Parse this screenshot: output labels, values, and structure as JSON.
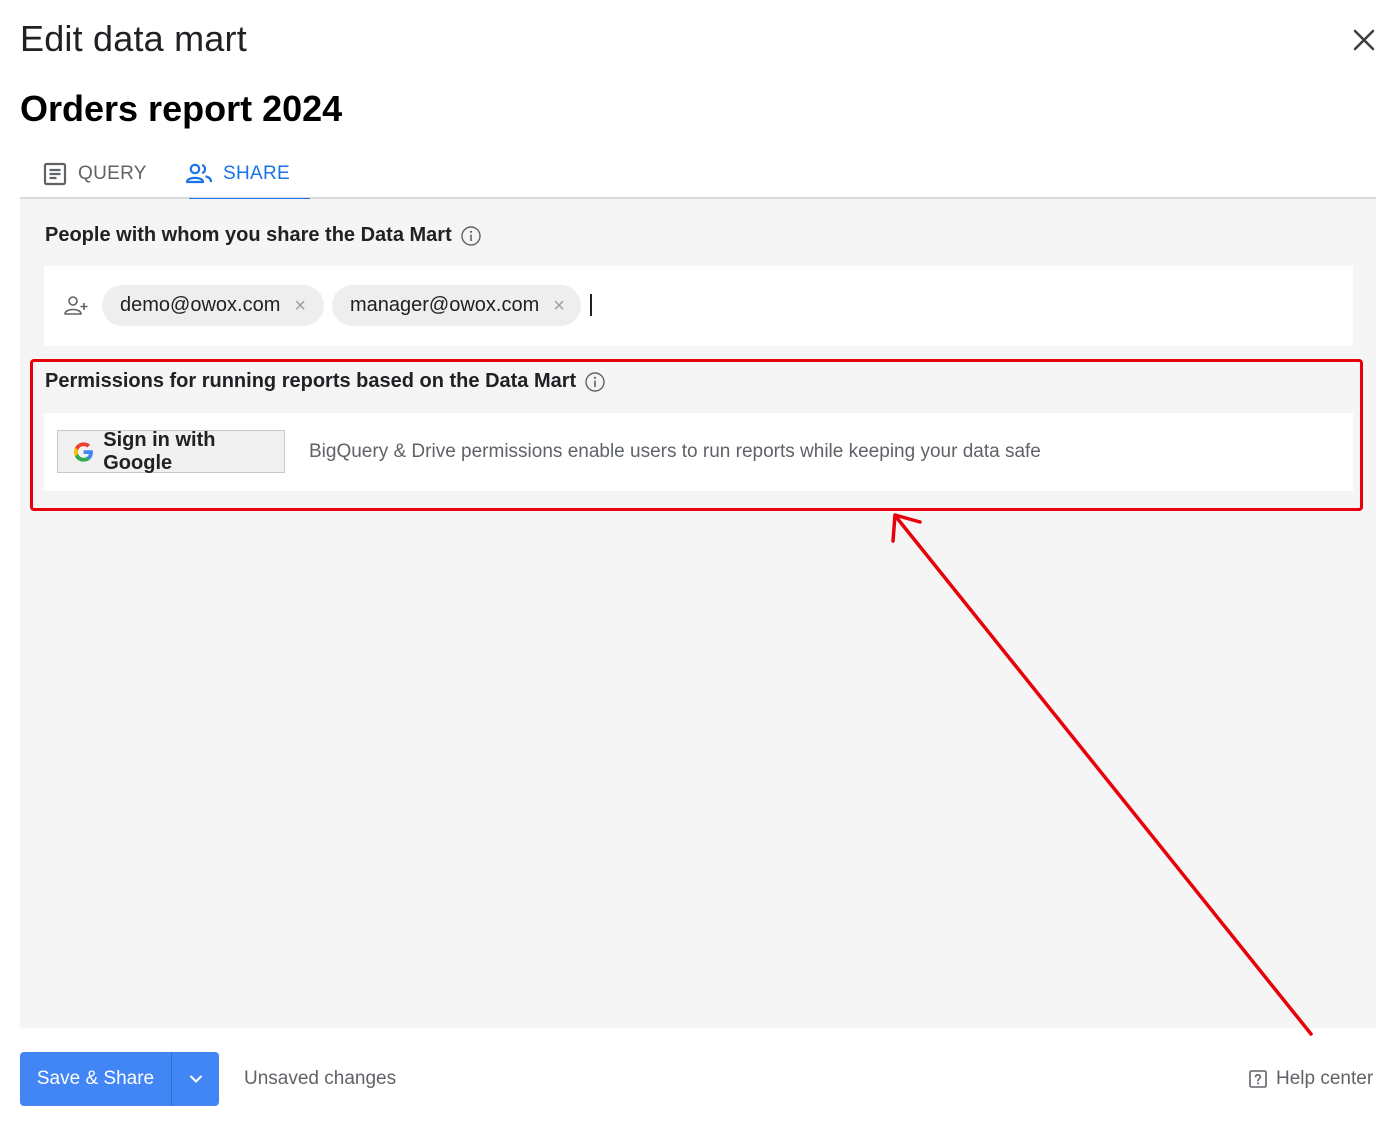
{
  "dialog": {
    "title": "Edit data mart",
    "close_icon": "close-icon"
  },
  "report": {
    "title": "Orders report 2024"
  },
  "tabs": [
    {
      "label": "QUERY",
      "icon": "document-icon",
      "active": false
    },
    {
      "label": "SHARE",
      "icon": "people-icon",
      "active": true
    }
  ],
  "share": {
    "people_label": "People with whom you share the Data Mart",
    "people_info_icon": "info-icon",
    "add_person_icon": "add-person-icon",
    "recipients": [
      {
        "email": "demo@owox.com"
      },
      {
        "email": "manager@owox.com"
      }
    ],
    "permissions_label": "Permissions for running reports based on the Data Mart",
    "permissions_info_icon": "info-icon",
    "google_button_label": "Sign in with Google",
    "permissions_description": "BigQuery & Drive permissions enable users to run reports while keeping your data safe"
  },
  "footer": {
    "save_label": "Save & Share",
    "dropdown_icon": "chevron-down-icon",
    "status": "Unsaved changes",
    "help_label": "Help center",
    "help_icon": "help-icon"
  },
  "colors": {
    "accent": "#1a73e8",
    "button": "#4285f4",
    "panel_bg": "#f5f5f5",
    "annotation": "#e8000b"
  }
}
